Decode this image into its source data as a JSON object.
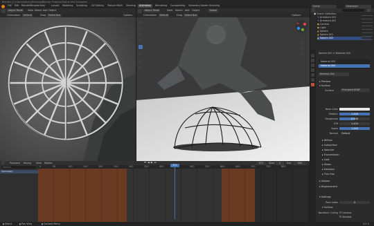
{
  "window": {
    "title": "Blender [C:\\Users\\Admin\\Desktop\\Blender Projects\\Statue and Animated Helmet\\Statue_Helmet_Animation.blend]"
  },
  "menu": {
    "items": [
      "File",
      "Edit",
      "Render",
      "Window",
      "Help"
    ],
    "workspaces": [
      "Layout",
      "Modeling",
      "Sculpting",
      "UV Editing",
      "Texture Paint",
      "Shading",
      "Animation",
      "Rendering",
      "Compositing",
      "Geometry Nodes",
      "Scripting"
    ],
    "active_workspace": "Animation",
    "scene": "Scene",
    "view_layer": "ViewLayer"
  },
  "left_view": {
    "mode": "Object Mode",
    "menus": [
      "View",
      "Select",
      "Add",
      "Object"
    ],
    "orientation": "Orientation",
    "default": "Default",
    "drag": "Drag",
    "select_box": "Select Box",
    "options": "Options"
  },
  "right_view": {
    "mode": "Object Mode",
    "menus": [
      "View",
      "Select",
      "Add",
      "Object"
    ],
    "transform": "Global",
    "orientation": "Orientation",
    "default": "Default",
    "drag": "Drag",
    "select_box": "Select Box",
    "options": "Options"
  },
  "outliner": {
    "items": [
      {
        "label": "Scene Collection"
      },
      {
        "label": "Armature.001"
      },
      {
        "label": "Armature.002"
      },
      {
        "label": "Camera"
      },
      {
        "label": "Light"
      },
      {
        "label": "Sphere"
      },
      {
        "label": "Sphere.001"
      },
      {
        "label": "Sphere.002"
      }
    ]
  },
  "properties": {
    "object": "Sphere.002",
    "material_tab": "Material.004",
    "slots": [
      "Material.003",
      "Material.004"
    ],
    "material_name": "Material.004",
    "preview": "Preview",
    "surface": "Surface",
    "surface_shader": "Principled BSDF",
    "rows": [
      {
        "label": "Base Color",
        "value": ""
      },
      {
        "label": "Metallic",
        "value": "1.000"
      },
      {
        "label": "Roughness",
        "value": "0.500"
      },
      {
        "label": "IOR",
        "value": "1.450"
      },
      {
        "label": "Alpha",
        "value": "1.000"
      },
      {
        "label": "Normal",
        "value": "Default"
      }
    ],
    "subsections": [
      "Diffuse",
      "Subsurface",
      "Specular",
      "Transmission",
      "Coat",
      "Sheen",
      "Emission",
      "Thin Film"
    ],
    "sections": [
      "Volume",
      "Displacement",
      "Settings"
    ],
    "pass_index_label": "Pass Index",
    "pass_index": "0",
    "surface2": "Surface",
    "backface_culling": "Backface Culling",
    "camera": "Camera",
    "shadow": "Shadow"
  },
  "timeline": {
    "menus": [
      "Playback",
      "Keying",
      "View",
      "Marker"
    ],
    "frame_current": "371",
    "start_label": "Start",
    "start": "1",
    "end_label": "End",
    "end": "500",
    "frames": [
      "0",
      "50",
      "100",
      "150",
      "200",
      "250",
      "300",
      "350",
      "400",
      "450",
      "500",
      "550",
      "600",
      "650",
      "700",
      "750",
      "800"
    ],
    "row_label": "Summary",
    "search_placeholder": "Search"
  },
  "status": {
    "left": "Select",
    "mid": "Pan View",
    "right": "Context Menu",
    "version": "4.2.3"
  },
  "colors": {
    "accent": "#4772b3",
    "active_frame": "#3e71c2",
    "keyrange": "#6b3a22"
  }
}
